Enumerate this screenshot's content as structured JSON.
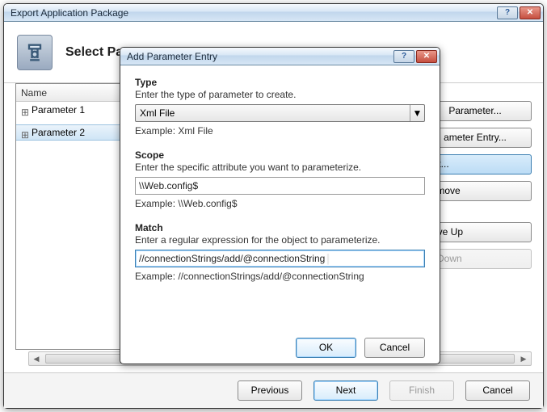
{
  "main_window": {
    "title": "Export Application Package",
    "banner_title": "Select Parameters",
    "tree": {
      "header": "Name",
      "items": [
        {
          "label": "Parameter 1"
        },
        {
          "label": "Parameter 2"
        }
      ]
    },
    "side_buttons": {
      "add_parameter": "Parameter...",
      "add_entry": "ameter Entry...",
      "edit": "Edit...",
      "remove": "Remove",
      "move_up": "Move Up",
      "move_down": "ve Down"
    },
    "bottom": {
      "previous": "Previous",
      "next": "Next",
      "finish": "Finish",
      "cancel": "Cancel"
    }
  },
  "dialog": {
    "title": "Add Parameter Entry",
    "type": {
      "label": "Type",
      "desc": "Enter the type of parameter to create.",
      "value": "Xml File",
      "example": "Example: Xml File"
    },
    "scope": {
      "label": "Scope",
      "desc": "Enter the specific attribute you want to parameterize.",
      "value": "\\\\Web.config$",
      "example": "Example: \\\\Web.config$"
    },
    "match": {
      "label": "Match",
      "desc": "Enter a regular expression for the object to parameterize.",
      "value": "//connectionStrings/add/@connectionString",
      "example": "Example: //connectionStrings/add/@connectionString"
    },
    "buttons": {
      "ok": "OK",
      "cancel": "Cancel"
    }
  }
}
